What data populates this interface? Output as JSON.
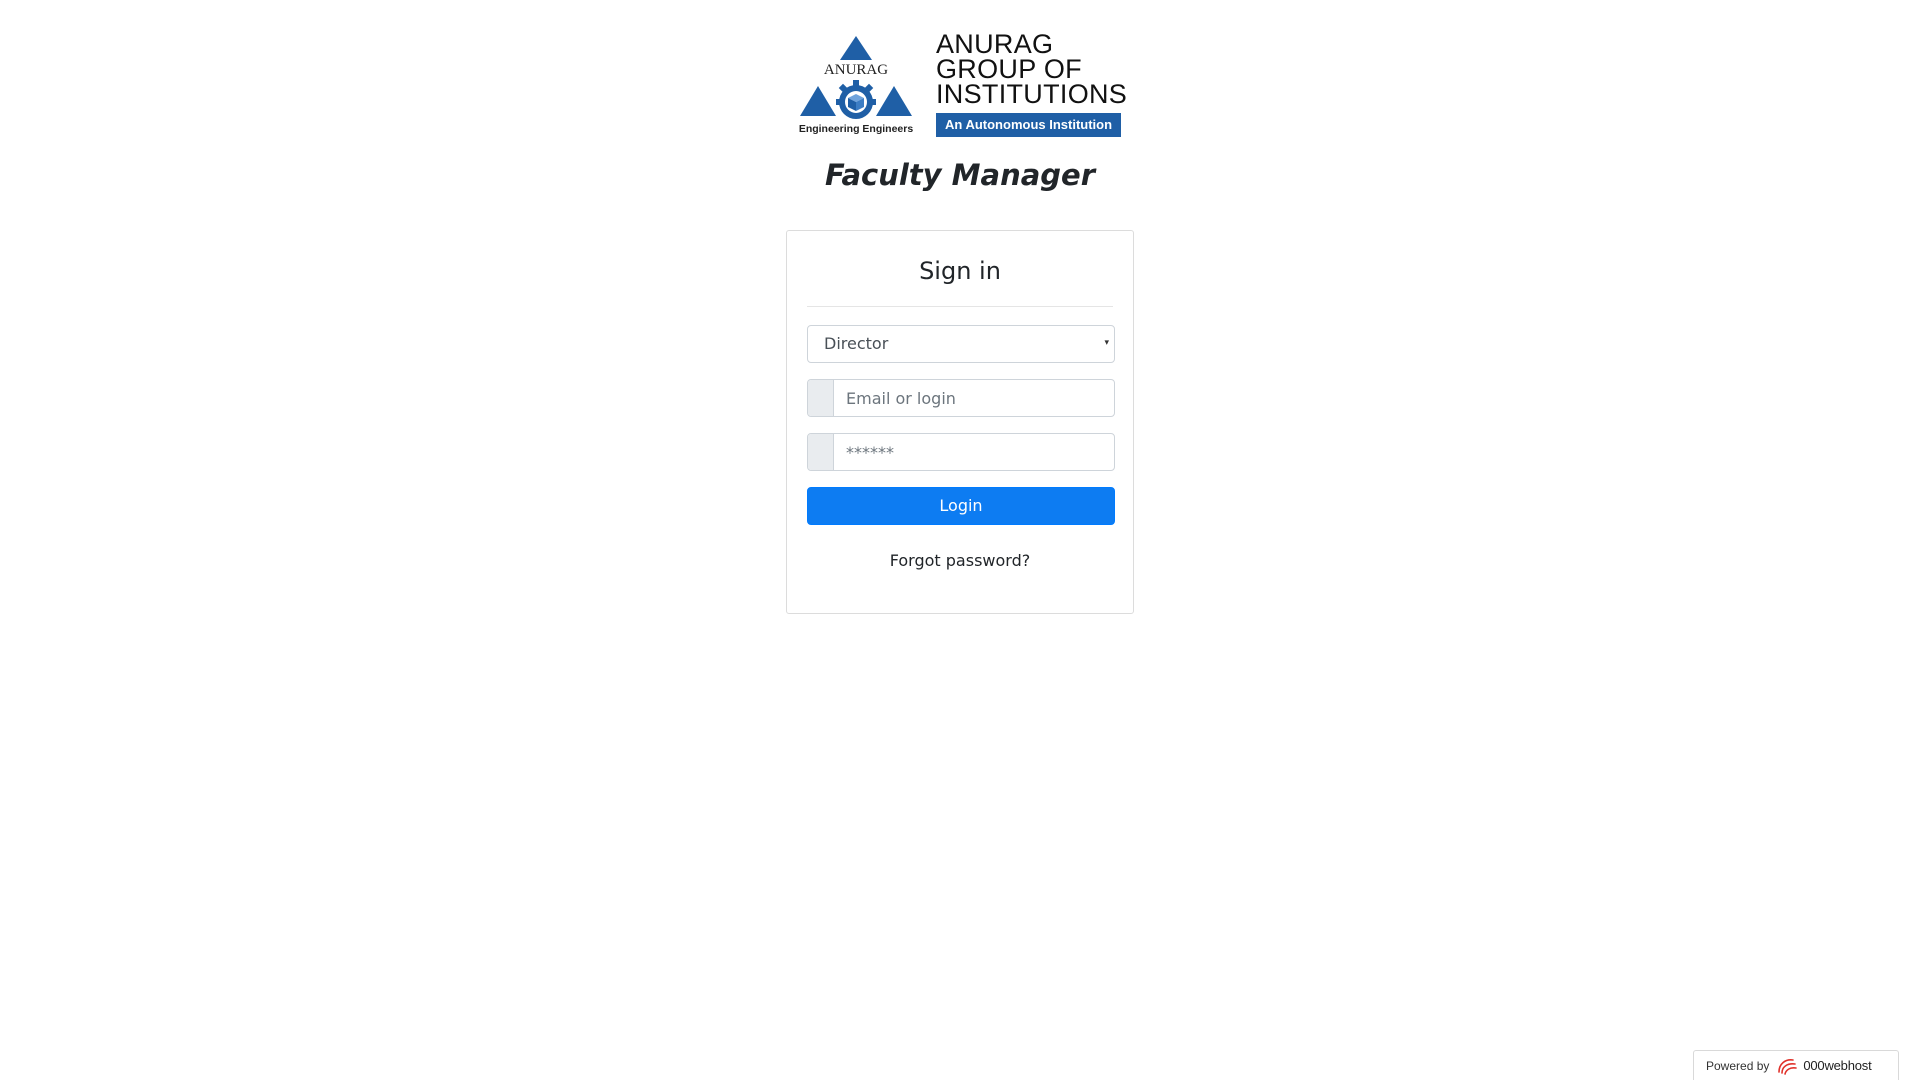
{
  "logo": {
    "emblem_text": "ANURAG",
    "emblem_caption": "Engineering Engineers",
    "line1": "ANURAG",
    "line2": "GROUP OF",
    "line3": "INSTITUTIONS",
    "tagline": "An Autonomous Institution"
  },
  "app_title": "Faculty Manager",
  "signin": {
    "title": "Sign in",
    "role_select": {
      "selected": "Director",
      "caret": "▾"
    },
    "email": {
      "placeholder": "Email or login",
      "value": ""
    },
    "password": {
      "placeholder": "******",
      "value": ""
    },
    "login_label": "Login",
    "forgot_label": "Forgot password?"
  },
  "footer_badge": {
    "prefix": "Powered by",
    "brand": "000webhost"
  },
  "colors": {
    "primary": "#0d7cf2",
    "logo_blue": "#1f5fa6",
    "brand_red": "#e0322b"
  },
  "icons": {
    "emblem": "anurag-emblem-icon",
    "caret": "chevron-down-icon",
    "webhost": "webhost-swirl-icon"
  }
}
